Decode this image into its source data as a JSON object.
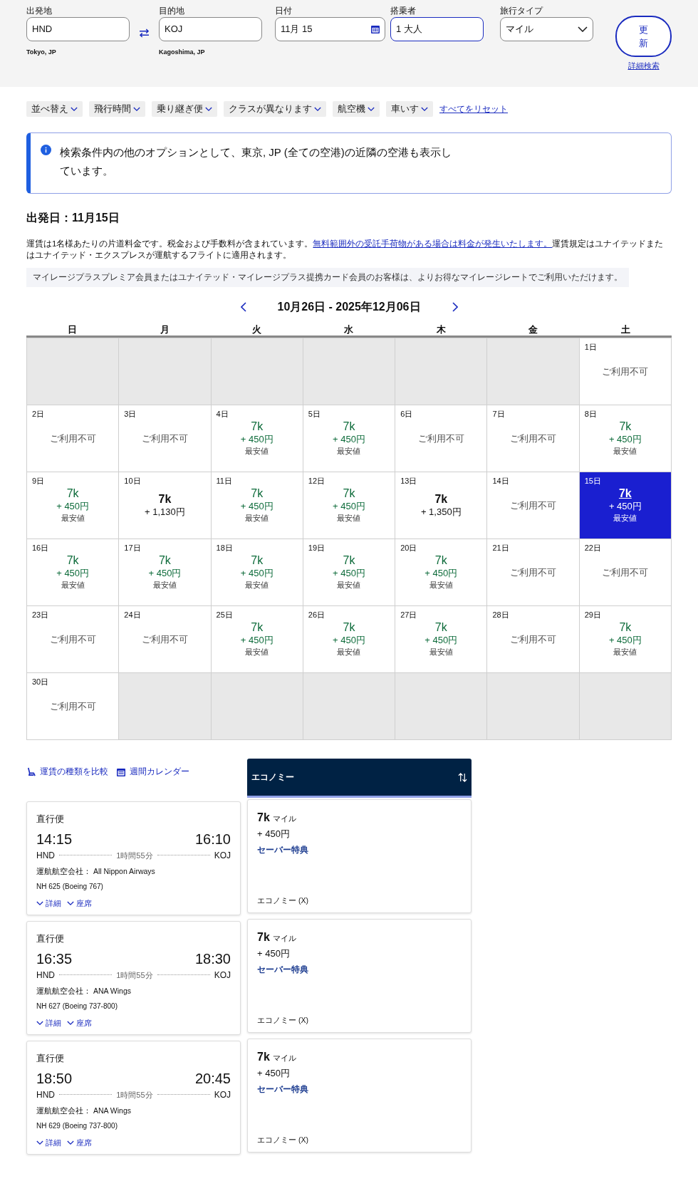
{
  "search": {
    "fields": [
      {
        "label": "出発地",
        "value": "HND",
        "caption": "Tokyo, JP",
        "kind": "text"
      },
      {
        "label": "目的地",
        "value": "KOJ",
        "caption": "Kagoshima, JP",
        "kind": "text"
      },
      {
        "label": "日付",
        "value": "11月 15",
        "kind": "date"
      },
      {
        "label": "搭乗者",
        "value": "1 大人",
        "kind": "text"
      },
      {
        "label": "旅行タイプ",
        "value": "マイル",
        "kind": "select"
      }
    ],
    "update_button": "更新",
    "advanced_link": "詳細検索"
  },
  "filters": [
    {
      "label": "並べ替え"
    },
    {
      "label": "飛行時間"
    },
    {
      "label": "乗り継ぎ便"
    },
    {
      "label": "クラスが異なります"
    },
    {
      "label": "航空機"
    },
    {
      "label": "車いす"
    }
  ],
  "reset_link": "すべてをリセット",
  "info_message": "検索条件内の他のオプションとして、東京, JP (全ての空港)の近隣の空港も表示しています。",
  "heading": "出発日：11月15日",
  "fare_note": {
    "text": "運賃は1名様あたりの片道料金です。税金および手数料が含まれています。",
    "link": "無料範囲外の受託手荷物がある場合は料金が発生いたします。",
    "text_after": "運賃規定はユナイテッドまたはユナイテッド・エクスプレスが運航するフライトに適用されます。"
  },
  "member_note": "マイレージプラスプレミア会員またはユナイテッド・マイレージプラス提携カード会員のお客様は、よりお得なマイレージレートでご利用いただけます。",
  "calendar": {
    "range": "10月26日 - 2025年12月06日",
    "weekdays": [
      "日",
      "月",
      "火",
      "水",
      "木",
      "金",
      "土"
    ],
    "cells": [
      {
        "kind": "empty"
      },
      {
        "kind": "empty"
      },
      {
        "kind": "empty"
      },
      {
        "kind": "empty"
      },
      {
        "kind": "empty"
      },
      {
        "kind": "empty"
      },
      {
        "kind": "unavailable",
        "day": "1日",
        "text": "ご利用不可",
        "selected": false
      },
      {
        "kind": "unavailable",
        "day": "2日",
        "text": "ご利用不可",
        "selected": false
      },
      {
        "kind": "unavailable",
        "day": "3日",
        "text": "ご利用不可",
        "selected": false
      },
      {
        "kind": "price",
        "day": "4日",
        "miles": "7k",
        "fee": "+ 450円",
        "badge": "最安値",
        "selected": false
      },
      {
        "kind": "price",
        "day": "5日",
        "miles": "7k",
        "fee": "+ 450円",
        "badge": "最安値",
        "selected": false
      },
      {
        "kind": "unavailable",
        "day": "6日",
        "text": "ご利用不可",
        "selected": false
      },
      {
        "kind": "unavailable",
        "day": "7日",
        "text": "ご利用不可",
        "selected": false
      },
      {
        "kind": "price",
        "day": "8日",
        "miles": "7k",
        "fee": "+ 450円",
        "badge": "最安値",
        "selected": false
      },
      {
        "kind": "price",
        "day": "9日",
        "miles": "7k",
        "fee": "+ 450円",
        "badge": "最安値",
        "selected": false
      },
      {
        "kind": "price",
        "day": "10日",
        "miles": "7k",
        "fee": "+ 1,130円",
        "selected": false
      },
      {
        "kind": "price",
        "day": "11日",
        "miles": "7k",
        "fee": "+ 450円",
        "badge": "最安値",
        "selected": false
      },
      {
        "kind": "price",
        "day": "12日",
        "miles": "7k",
        "fee": "+ 450円",
        "badge": "最安値",
        "selected": false
      },
      {
        "kind": "price",
        "day": "13日",
        "miles": "7k",
        "fee": "+ 1,350円",
        "selected": false
      },
      {
        "kind": "unavailable",
        "day": "14日",
        "text": "ご利用不可",
        "selected": false
      },
      {
        "kind": "price",
        "day": "15日",
        "miles": "7k",
        "fee": "+ 450円",
        "badge": "最安値",
        "selected": true
      },
      {
        "kind": "price",
        "day": "16日",
        "miles": "7k",
        "fee": "+ 450円",
        "badge": "最安値",
        "selected": false
      },
      {
        "kind": "price",
        "day": "17日",
        "miles": "7k",
        "fee": "+ 450円",
        "badge": "最安値",
        "selected": false
      },
      {
        "kind": "price",
        "day": "18日",
        "miles": "7k",
        "fee": "+ 450円",
        "badge": "最安値",
        "selected": false
      },
      {
        "kind": "price",
        "day": "19日",
        "miles": "7k",
        "fee": "+ 450円",
        "badge": "最安値",
        "selected": false
      },
      {
        "kind": "price",
        "day": "20日",
        "miles": "7k",
        "fee": "+ 450円",
        "badge": "最安値",
        "selected": false
      },
      {
        "kind": "unavailable",
        "day": "21日",
        "text": "ご利用不可",
        "selected": false
      },
      {
        "kind": "unavailable",
        "day": "22日",
        "text": "ご利用不可",
        "selected": false
      },
      {
        "kind": "unavailable",
        "day": "23日",
        "text": "ご利用不可",
        "selected": false
      },
      {
        "kind": "unavailable",
        "day": "24日",
        "text": "ご利用不可",
        "selected": false
      },
      {
        "kind": "price",
        "day": "25日",
        "miles": "7k",
        "fee": "+ 450円",
        "badge": "最安値",
        "selected": false
      },
      {
        "kind": "price",
        "day": "26日",
        "miles": "7k",
        "fee": "+ 450円",
        "badge": "最安値",
        "selected": false
      },
      {
        "kind": "price",
        "day": "27日",
        "miles": "7k",
        "fee": "+ 450円",
        "badge": "最安値",
        "selected": false
      },
      {
        "kind": "unavailable",
        "day": "28日",
        "text": "ご利用不可",
        "selected": false
      },
      {
        "kind": "price",
        "day": "29日",
        "miles": "7k",
        "fee": "+ 450円",
        "badge": "最安値",
        "selected": false
      },
      {
        "kind": "unavailable",
        "day": "30日",
        "text": "ご利用不可",
        "selected": false
      },
      {
        "kind": "empty"
      },
      {
        "kind": "empty"
      },
      {
        "kind": "empty"
      },
      {
        "kind": "empty"
      },
      {
        "kind": "empty"
      },
      {
        "kind": "empty"
      }
    ]
  },
  "view_links": [
    {
      "label": "運賃の種類を比較",
      "kind": "seat"
    },
    {
      "label": "週間カレンダー",
      "kind": "calendar"
    }
  ],
  "cabin_header": "エコノミー",
  "flights": [
    {
      "type": "直行便",
      "depart": "14:15",
      "arrive": "16:10",
      "from": "HND",
      "to": "KOJ",
      "duration": "1時間55分",
      "operator": "運航航空会社： All Nippon Airways",
      "flight": "NH 625 (Boeing 767)",
      "details": "詳細",
      "seats": "座席",
      "miles": "7k",
      "miles_unit": "マイル",
      "fee": "+ 450円",
      "fare_type": "セーバー特典",
      "cabin": "エコノミー (X)"
    },
    {
      "type": "直行便",
      "depart": "16:35",
      "arrive": "18:30",
      "from": "HND",
      "to": "KOJ",
      "duration": "1時間55分",
      "operator": "運航航空会社： ANA Wings",
      "flight": "NH 627 (Boeing 737-800)",
      "details": "詳細",
      "seats": "座席",
      "miles": "7k",
      "miles_unit": "マイル",
      "fee": "+ 450円",
      "fare_type": "セーバー特典",
      "cabin": "エコノミー (X)"
    },
    {
      "type": "直行便",
      "depart": "18:50",
      "arrive": "20:45",
      "from": "HND",
      "to": "KOJ",
      "duration": "1時間55分",
      "operator": "運航航空会社： ANA Wings",
      "flight": "NH 629 (Boeing 737-800)",
      "details": "詳細",
      "seats": "座席",
      "miles": "7k",
      "miles_unit": "マイル",
      "fee": "+ 450円",
      "fare_type": "セーバー特典",
      "cabin": "エコノミー (X)"
    }
  ]
}
